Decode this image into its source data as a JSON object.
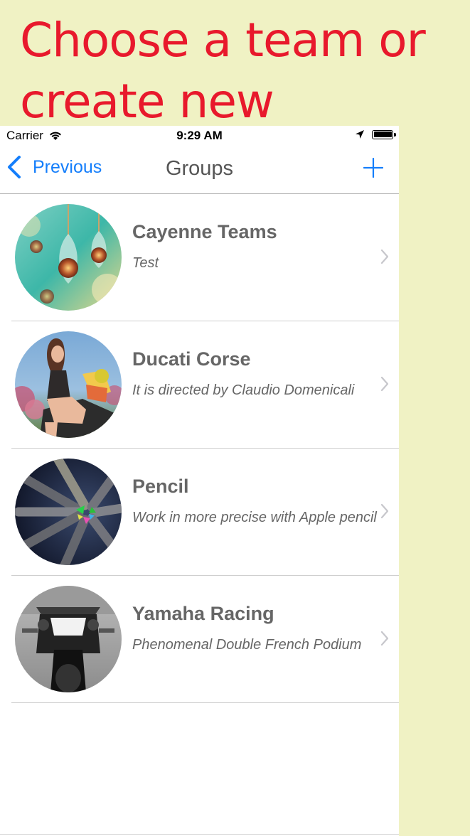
{
  "headline": {
    "line1": "Choose a team or",
    "line2": "create new"
  },
  "status_bar": {
    "carrier": "Carrier",
    "time": "9:29 AM",
    "wifi_icon": "wifi-icon",
    "location_icon": "location-arrow-icon",
    "battery_icon": "battery-full-icon",
    "battery_level": 1.0
  },
  "nav_bar": {
    "back_label": "Previous",
    "title": "Groups",
    "add_icon": "plus-icon"
  },
  "colors": {
    "accent": "#147efb",
    "headline": "#e8192c",
    "background": "#f0f2c4"
  },
  "groups": [
    {
      "title": "Cayenne Teams",
      "subtitle": "Test",
      "image": "hanging glass ornaments photo"
    },
    {
      "title": "Ducati Corse",
      "subtitle": "It is directed by Claudio Domenicali",
      "image": "woman on motorcycle photo"
    },
    {
      "title": "Pencil",
      "subtitle": "Work in more precise with Apple pencil",
      "image": "colored pencil tips photo"
    },
    {
      "title": "Yamaha Racing",
      "subtitle": "Phenomenal Double French Podium",
      "image": "black and white motorcycle photo"
    }
  ]
}
